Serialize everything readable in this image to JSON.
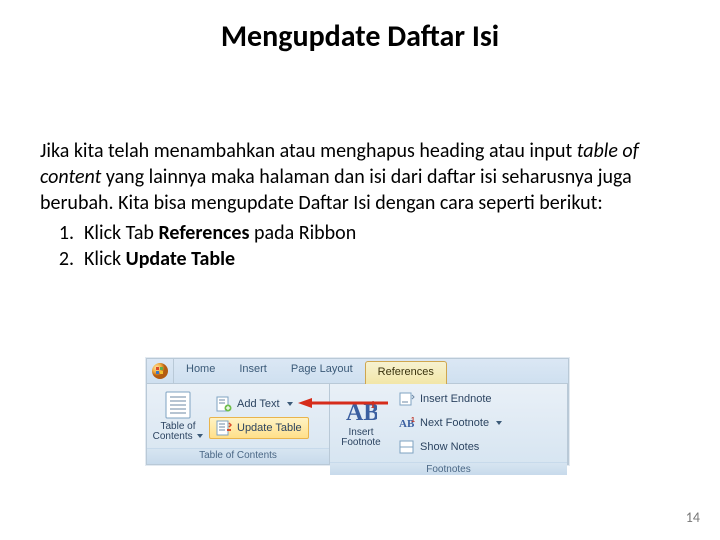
{
  "title": "Mengupdate Daftar Isi",
  "body": {
    "p1a": "Jika kita telah menambahkan atau menghapus heading atau input ",
    "p1_italic": "table of content",
    "p1b": " yang lainnya maka halaman dan isi dari daftar isi seharusnya juga berubah. Kita bisa mengupdate Daftar  Isi dengan cara seperti berikut:",
    "items": [
      {
        "num": "1.",
        "pre": "Klick Tab ",
        "bold": "References",
        "post": " pada Ribbon"
      },
      {
        "num": "2.",
        "pre": "Klick ",
        "bold": "Update Table",
        "post": ""
      }
    ]
  },
  "ribbon": {
    "tabs": {
      "home": "Home",
      "insert": "Insert",
      "pagelayout": "Page Layout",
      "references": "References"
    },
    "groups": {
      "toc": {
        "title": "Table of Contents",
        "big": "Table of\nContents",
        "addtext": "Add Text",
        "update": "Update Table"
      },
      "footnotes": {
        "title": "Footnotes",
        "big": "Insert\nFootnote",
        "endnote": "Insert Endnote",
        "next": "Next Footnote",
        "show": "Show Notes"
      }
    }
  },
  "page_number": "14"
}
